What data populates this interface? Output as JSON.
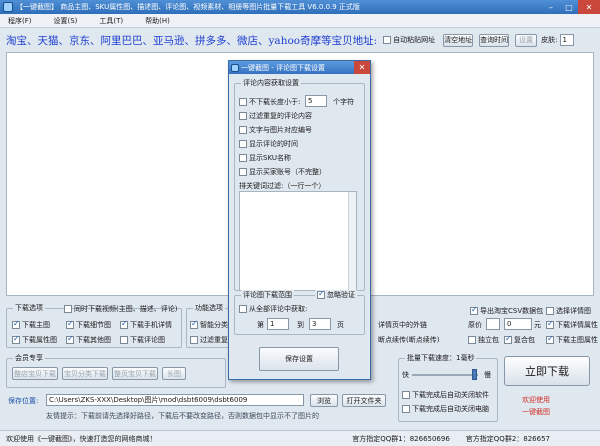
{
  "window": {
    "title": "【一键截图】 商品主图、SKU属性图、描述图、评论图、视频素材、相册等图片批量下载工具 V6.0.0.9 正式版"
  },
  "menu": [
    "程序(F)",
    "设置(S)",
    "工具(T)",
    "帮助(H)"
  ],
  "url_row": {
    "prompt": "淘宝、天猫、京东、阿里巴巴、亚马逊、拼多多、微店、yahoo奇摩等宝贝地址:",
    "auto_paste_label": "自动粘贴网址",
    "clear_label": "清空地址",
    "query_label": "查询时间",
    "settings_label": "设置",
    "skin_label": "皮肤:",
    "skin_value": "1"
  },
  "dialog": {
    "title": "一键截图 - 评论图下载设置",
    "section1_title": "评论内容获取设置",
    "min_len_prefix": "不下载长度小于:",
    "min_len_value": "5",
    "min_len_suffix": "个字符",
    "filter_dup": "过滤重复的评论内容",
    "text_to_image": "文字与图片对应编号",
    "show_time": "显示评论的时间",
    "show_sku": "显示SKU名称",
    "show_buyer": "显示买家账号（不完整）",
    "keyword_filter": "排关键词过滤:（一行一个）",
    "section2_title": "评论图下载范围",
    "skip_verify": "忽略验证",
    "from_all": "从全部评论中获取:",
    "page_prefix": "第",
    "page_from": "1",
    "page_mid": "到",
    "page_to": "3",
    "page_suffix": "页",
    "save_label": "保存设置"
  },
  "download_options": {
    "title": "下载选项",
    "sync_video": "同时下载视频(主图、描述、评论)",
    "items": [
      "下载主图",
      "下载细节图",
      "下载手机详情",
      "下载属性图",
      "下载其他图",
      "下载评论图"
    ]
  },
  "feature_options": {
    "title": "功能选项",
    "items": [
      "智能分类",
      "过滤重复"
    ]
  },
  "right_options": {
    "export_csv": "导出淘宝CSV数据包",
    "choose_details": "选择详情图",
    "detail_text": "详情页中的外链",
    "resume": "断点续传(断点续传)",
    "orig_size_label": "原价",
    "orig_size_value": "0",
    "orig_size_unit": "元",
    "single_cat": "独立包",
    "multi_cat": "复合包",
    "items": [
      "下载详情属性",
      "下载主图属性"
    ]
  },
  "member": {
    "title": "会员专享",
    "buttons": [
      "整店宝贝下载",
      "宝贝分类下载",
      "整页宝贝下载",
      "长图"
    ]
  },
  "save_path": {
    "label": "保存位置:",
    "value": "C:\\Users\\ZKS-XXX\\Desktop\\图片\\mod\\dsbt6009\\dsbt6009",
    "browse": "浏览",
    "open": "打开文件夹"
  },
  "hint": "友情提示：下载前请先选择好路径，下载后不要改变路径，否则数据包中显示不了图片的",
  "speed": {
    "title": "批量下载速度：1毫秒",
    "slow": "快",
    "fast": "慢",
    "shutdown1": "下载完成后自动关闭软件",
    "shutdown2": "下载完成后自动关闭电脑"
  },
  "download_now": "立即下载",
  "welcome_use": "欢迎使用",
  "one_key": "一键截图",
  "status": {
    "welcome": "欢迎使用《一键截图》，快速打造您的网络商城！",
    "qq1": "官方指定QQ群1：826650696",
    "qq2": "官方指定QQ群2：826657"
  }
}
